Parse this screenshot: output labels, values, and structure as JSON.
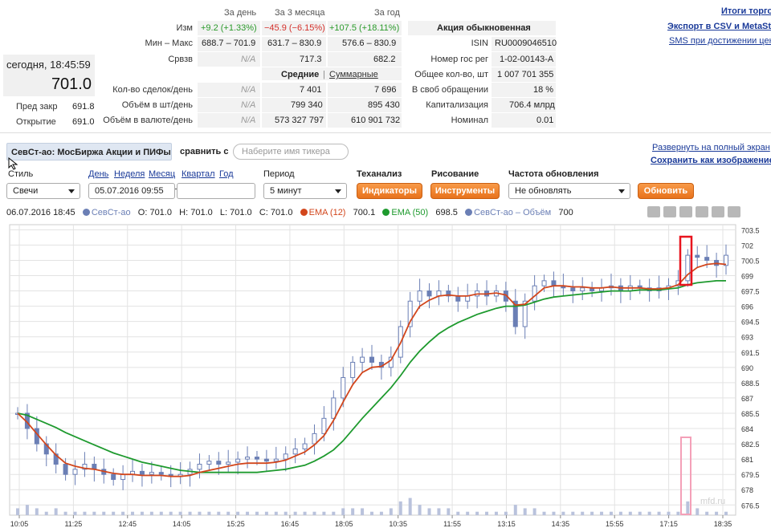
{
  "quote": {
    "time": "сегодня, 18:45:59",
    "price": "701.0",
    "prev_close_label": "Пред закр",
    "prev_close": "691.8",
    "open_label": "Открытие",
    "open": "691.0"
  },
  "stats": {
    "headers": [
      "За день",
      "За 3 месяца",
      "За год"
    ],
    "change_label": "Изм",
    "change": [
      "+9.2 (+1.33%)",
      "−45.9 (−6.15%)",
      "+107.5 (+18.11%)"
    ],
    "minmax_label": "Мин – Макс",
    "minmax": [
      "688.7 – 701.9",
      "631.7 – 830.9",
      "576.6 – 830.9"
    ],
    "avg_label": "Срвзв",
    "avg": [
      "N/A",
      "717.3",
      "682.2"
    ],
    "toggle_avg": "Средние",
    "toggle_sep": "|",
    "toggle_sum": "Суммарные",
    "deals_label": "Кол-во сделок/день",
    "deals": [
      "N/A",
      "7 401",
      "7 696"
    ],
    "vol_label": "Объём в шт/день",
    "vol": [
      "N/A",
      "799 340",
      "895 430"
    ],
    "volcur_label": "Объём в валюте/день",
    "volcur": [
      "N/A",
      "573 327 797",
      "610 901 732"
    ]
  },
  "info": {
    "title": "Акция обыкновенная",
    "rows": [
      {
        "label": "ISIN",
        "value": "RU0009046510"
      },
      {
        "label": "Номер гос рег",
        "value": "1-02-00143-A"
      },
      {
        "label": "Общее кол-во, шт",
        "value": "1 007 701 355"
      },
      {
        "label": "В своб обращении",
        "value": "18 %"
      },
      {
        "label": "Капитализация",
        "value": "706.4 млрд"
      },
      {
        "label": "Номинал",
        "value": "0.01"
      }
    ]
  },
  "links": {
    "results": "Итоги торгов",
    "export": "Экспорт в CSV и MetaStock",
    "sms": "SMS при достижении цены",
    "expand": "Развернуть на полный экран",
    "save": "Сохранить как изображение"
  },
  "toolbar": {
    "ticker": "СевСт-ао: МосБиржа Акции и ПИФы",
    "compare_label": "сравнить с",
    "compare_placeholder": "Наберите имя тикера",
    "style_label": "Стиль",
    "style_value": "Свечи",
    "periods": [
      "День",
      "Неделя",
      "Месяц",
      "Квартал",
      "Год"
    ],
    "date_from": "05.07.2016 09:55",
    "date_to": "",
    "interval_label": "Период",
    "interval_value": "5 минут",
    "ta_label": "Теханализ",
    "ta_button": "Индикаторы",
    "draw_label": "Рисование",
    "draw_button": "Инструменты",
    "freq_label": "Частота обновления",
    "freq_value": "Не обновлять",
    "refresh_button": "Обновить"
  },
  "legend": {
    "date": "06.07.2016 18:45",
    "ticker": "СевСт-ао",
    "o": "O: 701.0",
    "h": "H: 701.0",
    "l": "L: 701.0",
    "c": "C: 701.0",
    "ema12_label": "EMA (12)",
    "ema12_value": "700.1",
    "ema50_label": "EMA (50)",
    "ema50_value": "698.5",
    "vol_label": "СевСт-ао – Объём",
    "vol_value": "700",
    "colors": {
      "ticker": "#6b7fb5",
      "ema12": "#d2461c",
      "ema50": "#1e9a2e",
      "volume": "#6b7fb5"
    }
  },
  "watermark": "mfd.ru",
  "chart_data": {
    "type": "line",
    "title": "",
    "xlabel": "",
    "ylabel": "",
    "ylim": [
      675.5,
      704
    ],
    "yticks": [
      "703.5",
      "702",
      "700.5",
      "699",
      "697.5",
      "696",
      "694.5",
      "693",
      "691.5",
      "690",
      "688.5",
      "687",
      "685.5",
      "684",
      "682.5",
      "681",
      "679.5",
      "678",
      "676.5"
    ],
    "xticks": [
      "10:05",
      "11:25",
      "12:45",
      "14:05",
      "15:25",
      "16:45",
      "18:05",
      "10:35",
      "11:55",
      "13:15",
      "14:35",
      "15:55",
      "17:15",
      "18:35"
    ],
    "grid": true,
    "series": [
      {
        "name": "СевСт-ао",
        "kind": "candlestick-close",
        "values": [
          685.5,
          684.0,
          682.5,
          681.5,
          680.5,
          679.5,
          680.0,
          680.5,
          680.0,
          679.5,
          679.0,
          679.5,
          679.8,
          679.5,
          679.7,
          679.5,
          679.3,
          679.5,
          680.0,
          680.5,
          680.8,
          680.5,
          680.7,
          681.0,
          681.2,
          681.0,
          680.8,
          681.0,
          681.5,
          682.0,
          682.5,
          683.5,
          685.0,
          687.0,
          689.0,
          690.5,
          691.0,
          690.5,
          690.0,
          691.0,
          694.0,
          696.5,
          697.5,
          697.0,
          697.5,
          697.0,
          696.5,
          697.0,
          697.5,
          697.0,
          697.5,
          696.5,
          694.0,
          696.5,
          698.0,
          698.5,
          698.0,
          697.8,
          697.5,
          697.8,
          697.5,
          697.8,
          698.0,
          697.5,
          698.0,
          697.8,
          697.5,
          697.8,
          698.0,
          698.5,
          701.0,
          700.8,
          700.5,
          700.0,
          701.0
        ]
      },
      {
        "name": "EMA (12)",
        "values": [
          685.5,
          684.6,
          683.5,
          682.4,
          681.4,
          680.6,
          680.3,
          680.1,
          680.0,
          679.8,
          679.6,
          679.5,
          679.5,
          679.4,
          679.4,
          679.4,
          679.3,
          679.3,
          679.4,
          679.7,
          679.9,
          680.1,
          680.3,
          680.5,
          680.6,
          680.6,
          680.6,
          680.7,
          680.9,
          681.3,
          681.7,
          682.4,
          683.3,
          684.8,
          686.6,
          688.3,
          689.5,
          690.0,
          690.1,
          690.7,
          692.4,
          694.5,
          696.0,
          696.6,
          697.0,
          697.1,
          697.0,
          697.0,
          697.2,
          697.2,
          697.3,
          697.1,
          696.1,
          696.2,
          697.0,
          697.8,
          698.0,
          698.0,
          697.9,
          697.9,
          697.8,
          697.8,
          697.9,
          697.8,
          697.8,
          697.8,
          697.7,
          697.7,
          697.8,
          698.1,
          699.1,
          699.8,
          700.1,
          700.2,
          700.1
        ]
      },
      {
        "name": "EMA (50)",
        "values": [
          685.5,
          685.3,
          684.9,
          684.5,
          684.1,
          683.6,
          683.2,
          682.8,
          682.4,
          682.0,
          681.6,
          681.3,
          681.0,
          680.7,
          680.5,
          680.3,
          680.1,
          679.9,
          679.8,
          679.7,
          679.7,
          679.7,
          679.7,
          679.7,
          679.7,
          679.7,
          679.8,
          679.9,
          680.0,
          680.2,
          680.4,
          680.8,
          681.3,
          681.9,
          682.8,
          683.9,
          685.0,
          686.0,
          687.0,
          688.0,
          689.2,
          690.5,
          691.6,
          692.5,
          693.3,
          693.9,
          694.4,
          694.8,
          695.2,
          695.5,
          695.8,
          696.0,
          696.0,
          696.1,
          696.4,
          696.7,
          696.9,
          697.0,
          697.1,
          697.2,
          697.3,
          697.4,
          697.5,
          697.5,
          697.5,
          697.6,
          697.6,
          697.6,
          697.7,
          697.8,
          698.1,
          698.3,
          698.4,
          698.5,
          698.5
        ]
      },
      {
        "name": "СевСт-ао – Объём",
        "kind": "volume",
        "values": [
          2,
          3,
          2,
          1,
          2,
          1,
          1,
          1,
          1,
          1,
          1,
          1,
          1,
          1,
          1,
          1,
          1,
          1,
          1,
          1,
          1,
          1,
          1,
          1,
          1,
          1,
          1,
          1,
          1,
          1,
          1,
          1,
          1,
          1,
          2,
          2,
          2,
          1,
          1,
          2,
          4,
          5,
          3,
          2,
          2,
          2,
          1,
          1,
          1,
          1,
          1,
          1,
          3,
          2,
          2,
          1,
          1,
          1,
          1,
          1,
          1,
          1,
          1,
          1,
          1,
          1,
          1,
          1,
          1,
          1,
          4,
          2,
          1,
          1,
          1
        ]
      }
    ]
  }
}
